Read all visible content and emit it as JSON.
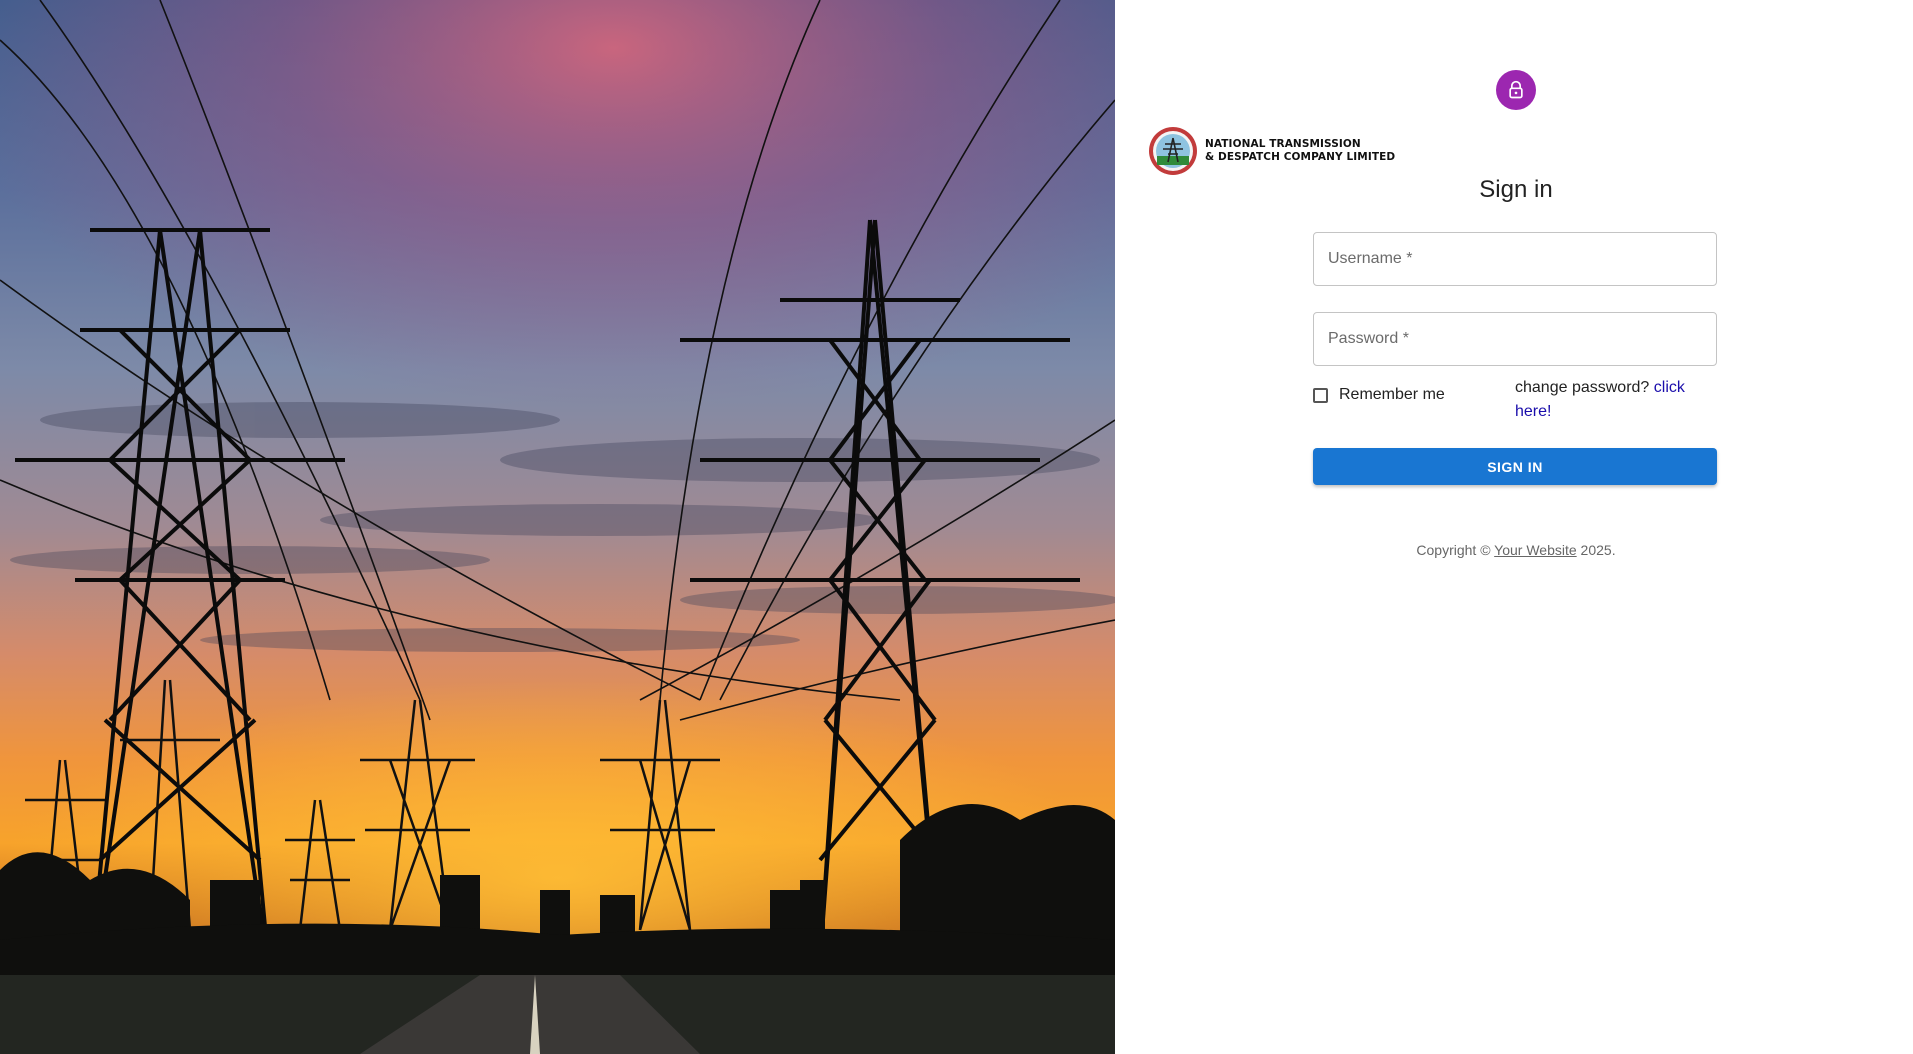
{
  "brand": {
    "line1": "NATIONAL TRANSMISSION",
    "line2": "& DESPATCH COMPANY LIMITED"
  },
  "icons": {
    "avatar": "lock-icon",
    "logo": "company-seal-logo"
  },
  "colors": {
    "avatar_bg": "#9c27b0",
    "primary": "#1976d2",
    "link": "#1a0dab"
  },
  "form": {
    "title": "Sign in",
    "username_placeholder": "Username *",
    "password_placeholder": "Password *",
    "remember_label": "Remember me",
    "change_password_text": "change password?",
    "change_password_link": "click here!",
    "submit_label": "SIGN IN"
  },
  "footer": {
    "prefix": "Copyright ©",
    "link": "Your Website",
    "suffix": "2025."
  }
}
